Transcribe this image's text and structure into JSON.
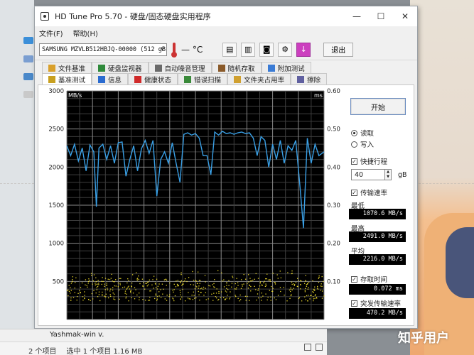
{
  "window": {
    "title": "HD Tune Pro 5.70 - 硬盘/固态硬盘实用程序",
    "controls": {
      "minimize": "—",
      "maximize": "☐",
      "close": "✕"
    }
  },
  "menu": {
    "file": "文件(F)",
    "help": "帮助(H)"
  },
  "toolbar": {
    "drive": "SAMSUNG MZVLB512HBJQ-00000 (512 gB)",
    "temperature": "— °C",
    "exit_label": "退出"
  },
  "tabs": {
    "top": [
      "文件基准",
      "硬盘监视器",
      "自动噪音管理",
      "随机存取",
      "附加测试"
    ],
    "bottom": [
      "基准测试",
      "信息",
      "健康状态",
      "错误扫描",
      "文件夹占用率",
      "擦除"
    ],
    "active": "基准测试"
  },
  "side": {
    "start_button": "开始",
    "read_label": "读取",
    "write_label": "写入",
    "mode": "read",
    "short_stroke_label": "快捷行程",
    "short_stroke_checked": true,
    "short_stroke_value": "40",
    "short_stroke_unit": "gB",
    "transfer_rate_label": "传输速率",
    "transfer_rate_checked": true,
    "min_label": "最低",
    "min_value": "1070.6 MB/s",
    "max_label": "最高",
    "max_value": "2491.0 MB/s",
    "avg_label": "平均",
    "avg_value": "2216.0 MB/s",
    "access_time_label": "存取时间",
    "access_time_checked": true,
    "access_time_value": "0.072 ms",
    "burst_label": "突发传输速率",
    "burst_checked": true,
    "burst_value": "470.2 MB/s"
  },
  "chart_data": {
    "type": "line",
    "y_left_unit": "MB/s",
    "y_right_unit": "ms",
    "y_left_ticks": [
      "3000",
      "2500",
      "2000",
      "1500",
      "1000",
      "500"
    ],
    "y_right_ticks": [
      "0.60",
      "0.50",
      "0.40",
      "0.30",
      "0.20",
      "0.10"
    ],
    "ylim_left": [
      0,
      3000
    ],
    "ylim_right": [
      0,
      0.6
    ],
    "xlim": [
      0,
      40
    ],
    "grid": true,
    "background": "#000000",
    "series": [
      {
        "color": "#3aa0e6",
        "x": [
          0,
          0.6,
          1.2,
          1.8,
          2.4,
          3.0,
          3.6,
          4.2,
          4.6,
          5.0,
          5.6,
          6.2,
          6.8,
          7.4,
          8.0,
          8.6,
          9.2,
          9.8,
          10.4,
          11.0,
          11.6,
          12.2,
          12.8,
          13.4,
          14.0,
          14.6,
          15.2,
          15.8,
          16.4,
          17.0,
          17.6,
          18.2,
          18.8,
          19.4,
          20.0,
          20.6,
          21.2,
          21.8,
          22.4,
          23.0,
          23.6,
          24.2,
          24.8,
          25.4,
          26.0,
          26.6,
          27.2,
          27.8,
          28.4,
          29.0,
          29.6,
          30.2,
          30.8,
          31.4,
          32.0,
          32.6,
          33.2,
          33.8,
          34.4,
          35.0,
          35.6,
          36.2,
          36.8,
          37.4,
          38.0,
          38.6,
          39.2,
          40.0
        ],
        "values": [
          2280,
          2150,
          2300,
          2080,
          2250,
          1950,
          2290,
          2200,
          1480,
          2250,
          2300,
          2100,
          2280,
          2050,
          2320,
          2330,
          1880,
          2100,
          2280,
          1950,
          2240,
          2350,
          2180,
          2350,
          1620,
          2100,
          2200,
          2050,
          2320,
          2050,
          1800,
          2430,
          2450,
          2420,
          2440,
          2380,
          2150,
          2150,
          1900,
          2460,
          2420,
          2470,
          2440,
          2450,
          2430,
          2450,
          2460,
          2440,
          2450,
          2380,
          2150,
          2400,
          2350,
          2000,
          2300,
          2100,
          2350,
          2050,
          2280,
          2220,
          2350,
          1800,
          1200,
          2380,
          2050,
          2300,
          2150,
          2200
        ]
      },
      {
        "color": "#e6d42a",
        "style": "scatter",
        "approx_level_ms": 0.08,
        "spread_ms": 0.03
      }
    ]
  }
}
